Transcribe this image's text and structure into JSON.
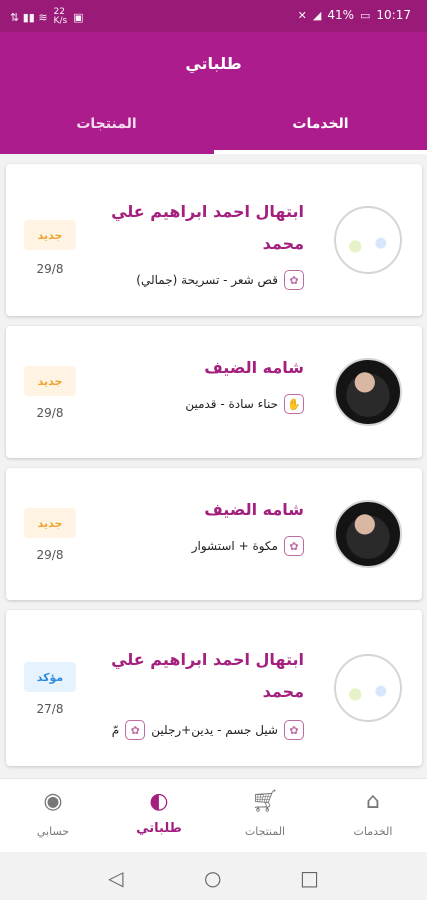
{
  "status_bar": {
    "left_text": "↓ 3G ≈ 22 ",
    "speed": "22\nK/s",
    "battery": "41%",
    "time": "10:17"
  },
  "app": {
    "title": "طلباتي",
    "tabs": [
      {
        "label": "المنتجات",
        "active": false
      },
      {
        "label": "الخدمات",
        "active": true
      }
    ]
  },
  "orders": [
    {
      "name_line1": "ابتهال احمد ابراهيم علي",
      "name_line2": "محمد",
      "service": "قص شعر - تسريحة (جمالي)",
      "status": "جديد",
      "status_type": "new",
      "date": "29/8",
      "avatar_type": "logo"
    },
    {
      "name_line1": "شامه الضيف",
      "service": "حناء سادة - قدمين",
      "status": "جديد",
      "status_type": "new",
      "date": "29/8",
      "avatar_type": "photo"
    },
    {
      "name_line1": "شامه الضيف",
      "service": "مكوة + استشوار",
      "status": "جديد",
      "status_type": "new",
      "date": "29/8",
      "avatar_type": "photo"
    },
    {
      "name_line1": "ابتهال احمد ابراهيم علي",
      "name_line2": "محمد",
      "service": "شيل جسم - يدين+رجلين",
      "service_extra": "مّ",
      "status": "مؤكد",
      "status_type": "confirmed",
      "date": "27/8",
      "avatar_type": "logo"
    }
  ],
  "bottom_nav": [
    {
      "label": "حسابي",
      "icon": "account-icon"
    },
    {
      "label": "طلباتي",
      "icon": "orders-icon",
      "active": true
    },
    {
      "label": "المنتجات",
      "icon": "cart-icon"
    },
    {
      "label": "الخدمات",
      "icon": "home-icon"
    }
  ],
  "colors": {
    "primary": "#ad1c8c",
    "status_bar": "#9a1a78",
    "name_text": "#a4207f",
    "badge_new_text": "#f0a234",
    "badge_confirmed_text": "#2d8bdc"
  }
}
